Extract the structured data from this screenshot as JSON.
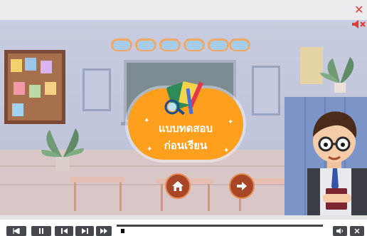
{
  "title_card": {
    "line1": "แบบทดสอบ",
    "line2": "ก่อนเรียน",
    "color": "#ff9f1e"
  },
  "top_controls": {
    "close_icon": "close-icon",
    "mute_icon": "speaker-mute-icon",
    "accent": "#e53935"
  },
  "nav_buttons": {
    "home_icon": "home-icon",
    "next_icon": "arrow-right-icon",
    "color": "#a74727"
  },
  "player_controls": {
    "buttons": [
      "rewind-start-icon",
      "pause-icon",
      "previous-icon",
      "next-icon",
      "fast-forward-icon"
    ],
    "volume_icon": "volume-icon",
    "close_icon": "close-icon",
    "progress": 0.02
  }
}
